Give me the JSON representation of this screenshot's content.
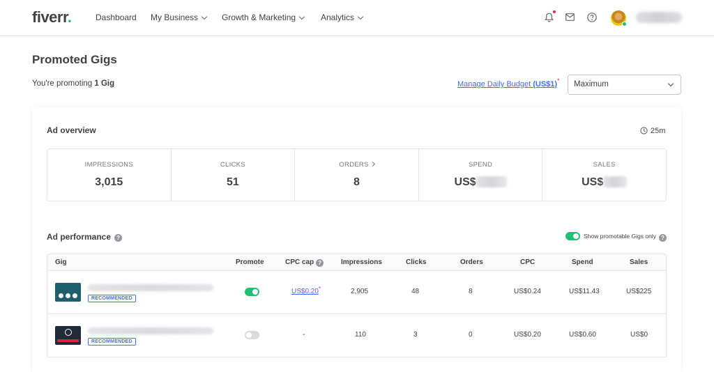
{
  "nav": {
    "logo": "fiverr",
    "logo_dot": ".",
    "items": [
      {
        "label": "Dashboard"
      },
      {
        "label": "My Business"
      },
      {
        "label": "Growth & Marketing"
      },
      {
        "label": "Analytics"
      }
    ],
    "icons": [
      "bell-icon",
      "mail-icon",
      "help-icon"
    ],
    "accent_color": "#1dbf73"
  },
  "header": {
    "title": "Promoted Gigs",
    "promoting_prefix": "You're promoting ",
    "promoting_count": "1 Gig",
    "budget_link_prefix": "Manage Daily Budget ",
    "budget_link_amount": "(US$1)",
    "required_mark": "*",
    "budget_select_value": "Maximum"
  },
  "overview": {
    "title": "Ad overview",
    "timer": "25m",
    "stats": [
      {
        "label": "IMPRESSIONS",
        "value": "3,015"
      },
      {
        "label": "CLICKS",
        "value": "51"
      },
      {
        "label": "ORDERS",
        "value": "8"
      },
      {
        "label": "SPEND",
        "value": "US$"
      },
      {
        "label": "SALES",
        "value": "US$"
      }
    ]
  },
  "performance": {
    "title": "Ad performance",
    "toggle_label": "Show promotable Gigs only",
    "toggle_on": true,
    "columns": [
      "Gig",
      "Promote",
      "CPC cap",
      "Impressions",
      "Clicks",
      "Orders",
      "CPC",
      "Spend",
      "Sales"
    ],
    "rows": [
      {
        "badge": "RECOMMENDED",
        "promote": true,
        "cpc_cap": "US$0.20",
        "impressions": "2,905",
        "clicks": "48",
        "orders": "8",
        "cpc": "US$0.24",
        "spend": "US$11.43",
        "sales": "US$225"
      },
      {
        "badge": "RECOMMENDED",
        "promote": false,
        "cpc_cap": "-",
        "impressions": "110",
        "clicks": "3",
        "orders": "0",
        "cpc": "US$0.20",
        "spend": "US$0.60",
        "sales": "US$0"
      }
    ]
  }
}
